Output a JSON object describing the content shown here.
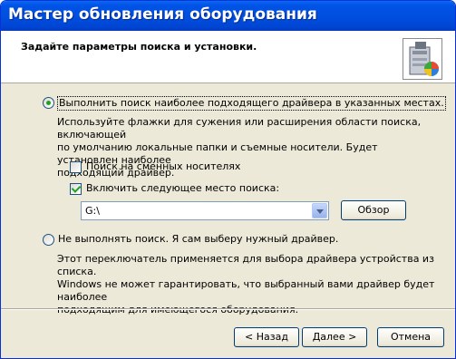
{
  "window": {
    "title": "Мастер обновления оборудования"
  },
  "header": {
    "title": "Задайте параметры поиска и установки."
  },
  "options": {
    "search": {
      "label": "Выполнить поиск наиболее подходящего драйвера в указанных местах.",
      "selected": true,
      "description_lines": [
        "Используйте флажки для сужения или расширения области поиска, включающей",
        "по умолчанию локальные папки и съемные носители. Будет установлен наиболее",
        "подходящий драйвер."
      ],
      "removable_media": {
        "label": "Поиск на сменных носителях",
        "checked": false
      },
      "include_location": {
        "label": "Включить следующее место поиска:",
        "checked": true
      },
      "location_value": "G:\\",
      "browse_label": "Обзор"
    },
    "manual": {
      "label": "Не выполнять поиск. Я сам выберу нужный драйвер.",
      "selected": false,
      "description_lines": [
        "Этот переключатель применяется для выбора драйвера устройства из списка.",
        "Windows не может гарантировать, что выбранный вами драйвер будет наиболее",
        "подходящим для имеющегося оборудования."
      ]
    }
  },
  "footer": {
    "back_label": "< Назад",
    "next_label": "Далее >",
    "cancel_label": "Отмена"
  }
}
